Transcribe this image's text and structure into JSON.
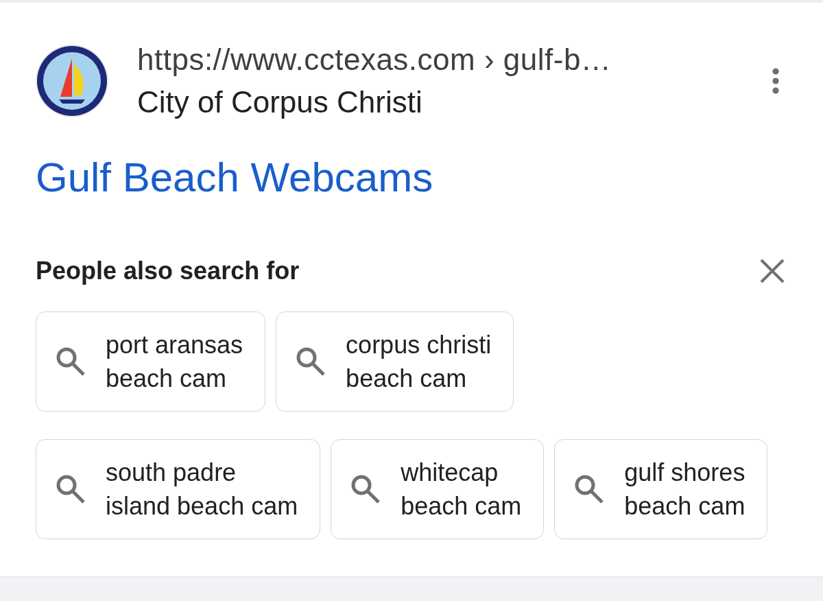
{
  "result": {
    "url": "https://www.cctexas.com › gulf-b…",
    "site_name": "City of Corpus Christi",
    "title": "Gulf Beach Webcams"
  },
  "related_searches": {
    "heading": "People also search for",
    "queries": [
      {
        "lines": [
          "port aransas",
          "beach cam"
        ]
      },
      {
        "lines": [
          "corpus christi",
          "beach cam"
        ]
      },
      {
        "lines": [
          "south padre",
          "island beach cam"
        ]
      },
      {
        "lines": [
          "whitecap",
          "beach cam"
        ]
      },
      {
        "lines": [
          "gulf shores",
          "beach cam"
        ]
      }
    ]
  }
}
